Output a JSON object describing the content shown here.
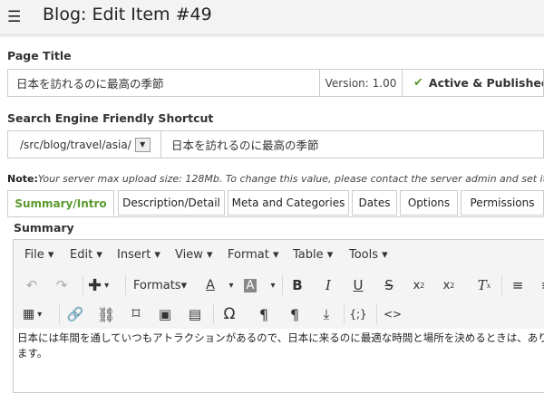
{
  "header": {
    "menu_icon": "☰",
    "title": "Blog: Edit Item #49"
  },
  "page_title": {
    "label": "Page Title",
    "value": "日本を訪れるのに最高の季節",
    "version": "Version: 1.00",
    "status_icon": "check-icon",
    "status": "Active & Published",
    "status_color": "#5b9a2e"
  },
  "shortcut": {
    "label": "Search Engine Friendly Shortcut",
    "path_select": "/src/blog/travel/asia/",
    "slug": "日本を訪れるのに最高の季節"
  },
  "note": {
    "prefix": "Note:",
    "text": "Your server max upload size: 128Mb. To change this value, please contact the server admin and set it in"
  },
  "tabs": [
    {
      "label": "Summary/Intro",
      "active": true
    },
    {
      "label": "Description/Detail"
    },
    {
      "label": "Meta and Categories"
    },
    {
      "label": "Dates"
    },
    {
      "label": "Options"
    },
    {
      "label": "Permissions"
    }
  ],
  "summary": {
    "label": "Summary"
  },
  "editor": {
    "menus": [
      "File",
      "Edit",
      "Insert",
      "View",
      "Format",
      "Table",
      "Tools"
    ],
    "formats_label": "Formats",
    "content": "日本には年間を通していつもアトラクションがあるので、日本に来るのに最適な時間と場所を決めるときは、あります。"
  }
}
